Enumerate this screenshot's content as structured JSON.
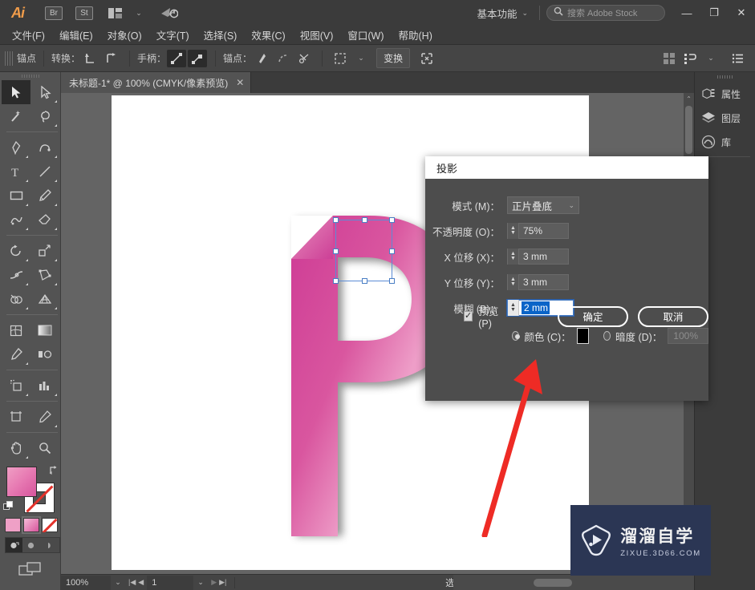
{
  "app": {
    "name": "Adobe Illustrator",
    "logo_text": "Ai"
  },
  "titlebar": {
    "bridge_label": "Br",
    "stock_label": "St",
    "arrange_icon": "arrange-documents-icon",
    "sync_icon": "cloud-sync-icon",
    "workspace": "基本功能",
    "workspace_caret": "⌄",
    "search_icon": "search-icon",
    "search_placeholder": "搜索 Adobe Stock",
    "minimize": "—",
    "maximize": "❐",
    "close": "✕"
  },
  "menubar": {
    "items": [
      {
        "label": "文件(F)"
      },
      {
        "label": "编辑(E)"
      },
      {
        "label": "对象(O)"
      },
      {
        "label": "文字(T)"
      },
      {
        "label": "选择(S)"
      },
      {
        "label": "效果(C)"
      },
      {
        "label": "视图(V)"
      },
      {
        "label": "窗口(W)"
      },
      {
        "label": "帮助(H)"
      }
    ]
  },
  "controlbar": {
    "title": "锚点",
    "convert_label": "转换：",
    "handles_label": "手柄：",
    "anchors_label": "锚点：",
    "transform_button": "变换",
    "align_icon": "align-icon",
    "arrange_icon": "arrange-objects-icon",
    "options_icon": "panel-options-icon"
  },
  "tab": {
    "title": "未标题-1* @ 100% (CMYK/像素预览)",
    "close": "✕"
  },
  "toolbar": {
    "tools": [
      {
        "name": "selection-tool",
        "glyph": "selection",
        "selected": true
      },
      {
        "name": "direct-selection-tool",
        "glyph": "direct-selection",
        "selected": false
      },
      {
        "name": "magic-wand-tool",
        "glyph": "magic-wand",
        "selected": false
      },
      {
        "name": "lasso-tool",
        "glyph": "lasso",
        "selected": false
      },
      {
        "name": "pen-tool",
        "glyph": "pen",
        "selected": false
      },
      {
        "name": "curvature-tool",
        "glyph": "curvature",
        "selected": false
      },
      {
        "name": "type-tool",
        "glyph": "type",
        "selected": false
      },
      {
        "name": "line-segment-tool",
        "glyph": "line",
        "selected": false
      },
      {
        "name": "rectangle-tool",
        "glyph": "rectangle",
        "selected": false
      },
      {
        "name": "paintbrush-tool",
        "glyph": "brush",
        "selected": false
      },
      {
        "name": "shaper-tool",
        "glyph": "shaper",
        "selected": false
      },
      {
        "name": "eraser-tool",
        "glyph": "eraser",
        "selected": false
      },
      {
        "name": "rotate-tool",
        "glyph": "rotate",
        "selected": false
      },
      {
        "name": "scale-tool",
        "glyph": "scale",
        "selected": false
      },
      {
        "name": "width-tool",
        "glyph": "width",
        "selected": false
      },
      {
        "name": "free-transform-tool",
        "glyph": "free-transform",
        "selected": false
      },
      {
        "name": "shape-builder-tool",
        "glyph": "shape-builder",
        "selected": false
      },
      {
        "name": "perspective-grid-tool",
        "glyph": "perspective-grid",
        "selected": false
      },
      {
        "name": "mesh-tool",
        "glyph": "mesh",
        "selected": false
      },
      {
        "name": "gradient-tool",
        "glyph": "gradient",
        "selected": false
      },
      {
        "name": "eyedropper-tool",
        "glyph": "eyedropper",
        "selected": false
      },
      {
        "name": "blend-tool",
        "glyph": "blend",
        "selected": false
      },
      {
        "name": "symbol-sprayer-tool",
        "glyph": "symbol-sprayer",
        "selected": false
      },
      {
        "name": "column-graph-tool",
        "glyph": "column-graph",
        "selected": false
      },
      {
        "name": "artboard-tool",
        "glyph": "artboard",
        "selected": false
      },
      {
        "name": "slice-tool",
        "glyph": "slice",
        "selected": false
      },
      {
        "name": "hand-tool",
        "glyph": "hand",
        "selected": false
      },
      {
        "name": "zoom-tool",
        "glyph": "zoom",
        "selected": false
      }
    ],
    "fill_color": "#e87db4",
    "stroke_color": "none",
    "fill_gradient": "linear-gradient pink",
    "swap_icon": "swap-fill-stroke-icon",
    "default_icon": "default-fill-stroke-icon",
    "modes": [
      {
        "name": "color-mode",
        "active": false
      },
      {
        "name": "gradient-mode",
        "active": true
      },
      {
        "name": "none-mode",
        "active": false
      }
    ],
    "screen_modes": [
      {
        "name": "normal-screen-mode",
        "active": true
      },
      {
        "name": "full-screen-menubar-mode",
        "active": false
      },
      {
        "name": "full-screen-mode",
        "active": false
      }
    ],
    "change_screen_icon": "change-screen-mode-icon"
  },
  "canvas": {
    "artboard_background": "#ffffff",
    "canvas_background": "#646464",
    "letter": "P",
    "letter_gradient_from": "#f09ec6",
    "letter_gradient_to": "#cc3f96",
    "selection_border": "#5b8cd6",
    "handle_fill": "#ffffff"
  },
  "right_dock": {
    "items": [
      {
        "label": "属性",
        "icon": "properties-icon"
      },
      {
        "label": "图层",
        "icon": "layers-icon"
      },
      {
        "label": "库",
        "icon": "libraries-icon"
      }
    ]
  },
  "dialog": {
    "title": "投影",
    "fields": {
      "mode_label": "模式 (M)：",
      "mode_value": "正片叠底",
      "mode_caret": "⌄",
      "opacity_label": "不透明度 (O)：",
      "opacity_value": "75%",
      "offset_x_label": "X 位移 (X)：",
      "offset_x_value": "3 mm",
      "offset_y_label": "Y 位移 (Y)：",
      "offset_y_value": "3 mm",
      "blur_label": "模糊 (B)：",
      "blur_value": "2 mm",
      "color_radio_label": "颜色 (C)：",
      "color_swatch": "#000000",
      "color_selected": true,
      "darkness_radio_label": "暗度 (D)：",
      "darkness_value": "100%",
      "darkness_selected": false
    },
    "preview_label": "预览 (P)",
    "preview_checked": true,
    "check_glyph": "✓",
    "ok_button": "确定",
    "cancel_button": "取消"
  },
  "statusbar": {
    "zoom": "100%",
    "zoom_caret": "⌄",
    "first_page_icon": "first-page-icon",
    "prev_page_icon": "prev-page-icon",
    "page_value": "1",
    "page_caret": "⌄",
    "next_page_icon": "next-page-icon",
    "last_page_icon": "last-page-icon",
    "status_text": "选择",
    "play_icon": "play-icon",
    "back_icon": "back-icon"
  },
  "watermark": {
    "title": "溜溜自学",
    "url": "ZIXUE.3D66.COM",
    "background": "#2b3654",
    "logo_icon": "play-button-logo-icon"
  },
  "annotation": {
    "arrow_color": "#ee2b25",
    "points_to": "确定"
  }
}
